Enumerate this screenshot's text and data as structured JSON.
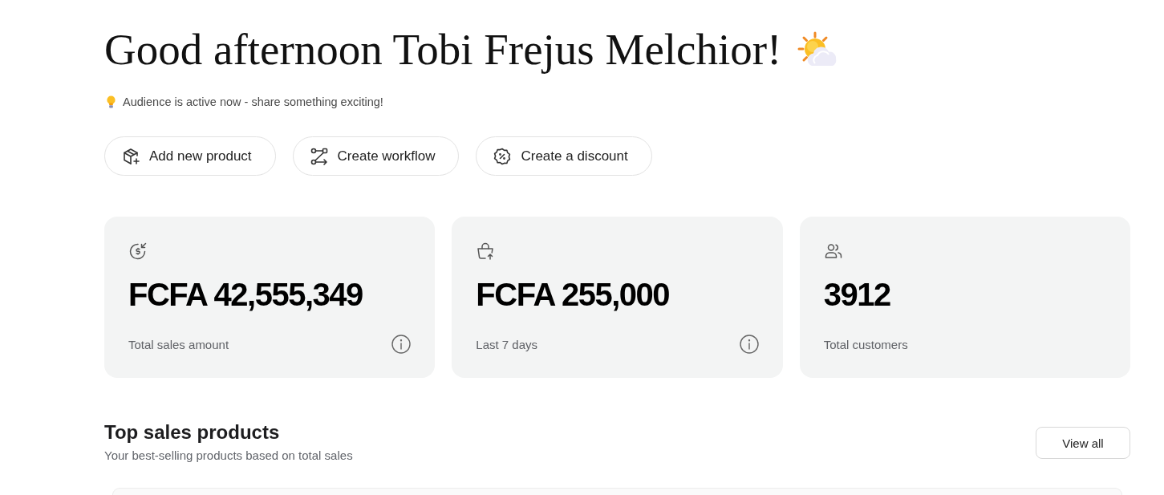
{
  "greeting": {
    "title": "Good afternoon Tobi Frejus Melchior!",
    "subtitle": "Audience is active now - share something exciting!"
  },
  "actions": [
    {
      "label": "Add new product",
      "kind": "product"
    },
    {
      "label": "Create workflow",
      "kind": "workflow"
    },
    {
      "label": "Create a discount",
      "kind": "discount"
    }
  ],
  "stats": [
    {
      "kind": "sales",
      "value": "FCFA 42,555,349",
      "label": "Total sales amount",
      "info": true
    },
    {
      "kind": "recent",
      "value": "FCFA 255,000",
      "label": "Last 7 days",
      "info": true
    },
    {
      "kind": "customers",
      "value": "3912",
      "label": "Total customers",
      "info": false
    }
  ],
  "top_products": {
    "title": "Top sales products",
    "subtitle": "Your best-selling products based on total sales",
    "button": "View all"
  }
}
